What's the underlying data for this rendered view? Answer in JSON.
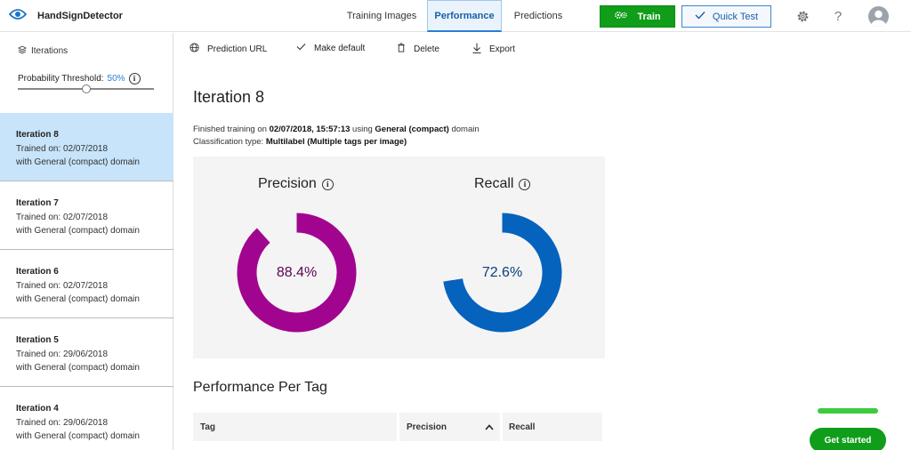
{
  "app": {
    "name": "HandSignDetector"
  },
  "nav": {
    "tabs": [
      {
        "label": "Training Images"
      },
      {
        "label": "Performance"
      },
      {
        "label": "Predictions"
      }
    ],
    "train_label": "Train",
    "quick_test_label": "Quick Test"
  },
  "sidebar": {
    "heading": "Iterations",
    "threshold_label": "Probability Threshold:",
    "threshold_value": "50%",
    "threshold_fraction": 0.5,
    "iterations": [
      {
        "name": "Iteration 8",
        "trained": "Trained on: 02/07/2018",
        "domain": "with General (compact) domain"
      },
      {
        "name": "Iteration 7",
        "trained": "Trained on: 02/07/2018",
        "domain": "with General (compact) domain"
      },
      {
        "name": "Iteration 6",
        "trained": "Trained on: 02/07/2018",
        "domain": "with General (compact) domain"
      },
      {
        "name": "Iteration 5",
        "trained": "Trained on: 29/06/2018",
        "domain": "with General (compact) domain"
      },
      {
        "name": "Iteration 4",
        "trained": "Trained on: 29/06/2018",
        "domain": "with General (compact) domain"
      }
    ]
  },
  "toolbar": {
    "prediction_url": "Prediction URL",
    "make_default": "Make default",
    "delete": "Delete",
    "export": "Export"
  },
  "main": {
    "title": "Iteration 8",
    "info_line1": {
      "prefix": "Finished training on ",
      "date": "02/07/2018, 15:57:13",
      "middle": " using ",
      "domain": "General (compact)",
      "suffix": " domain"
    },
    "info_line2": {
      "prefix": "Classification type: ",
      "type": "Multilabel (Multiple tags per image)"
    },
    "precision": {
      "label": "Precision",
      "value_text": "88.4%",
      "value": 0.884,
      "color": "#a1058f"
    },
    "recall": {
      "label": "Recall",
      "value_text": "72.6%",
      "value": 0.726,
      "color": "#0563bd"
    },
    "per_tag_title": "Performance Per Tag",
    "table_headers": {
      "tag": "Tag",
      "precision": "Precision",
      "recall": "Recall"
    }
  },
  "onboarding": {
    "progress": 1.0,
    "get_started": "Get started"
  }
}
